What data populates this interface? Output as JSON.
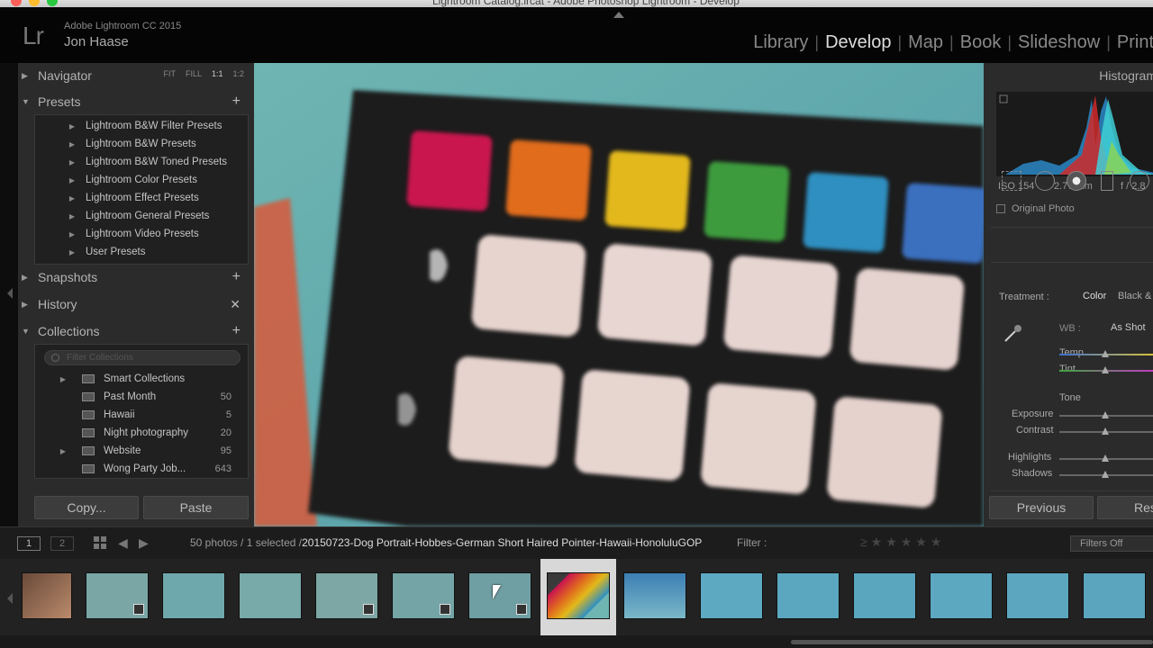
{
  "window": {
    "title": "Lightroom Catalog.lrcat - Adobe Photoshop Lightroom - Develop"
  },
  "identity": {
    "logo": "Lr",
    "product": "Adobe Lightroom CC 2015",
    "user": "Jon Haase"
  },
  "modules": [
    "Library",
    "Develop",
    "Map",
    "Book",
    "Slideshow",
    "Print"
  ],
  "active_module": "Develop",
  "left_panel": {
    "navigator": {
      "label": "Navigator",
      "options": [
        "FIT",
        "FILL",
        "1:1",
        "1:2"
      ]
    },
    "presets": {
      "label": "Presets",
      "items": [
        "Lightroom B&W Filter Presets",
        "Lightroom B&W Presets",
        "Lightroom B&W Toned Presets",
        "Lightroom Color Presets",
        "Lightroom Effect Presets",
        "Lightroom General Presets",
        "Lightroom Video Presets",
        "User Presets"
      ]
    },
    "snapshots": {
      "label": "Snapshots"
    },
    "history": {
      "label": "History"
    },
    "collections": {
      "label": "Collections",
      "filter_placeholder": "Filter Collections",
      "items": [
        {
          "name": "Smart Collections",
          "count": ""
        },
        {
          "name": "Past Month",
          "count": "50"
        },
        {
          "name": "Hawaii",
          "count": "5"
        },
        {
          "name": "Night photography",
          "count": "20"
        },
        {
          "name": "Website",
          "count": "95"
        },
        {
          "name": "Wong Party Job...",
          "count": "643"
        }
      ]
    },
    "copy_label": "Copy...",
    "paste_label": "Paste"
  },
  "right_panel": {
    "title": "Histogram",
    "iso": "ISO 154",
    "focal": "2.77 mm",
    "aperture": "f / 2.8",
    "original_photo": "Original Photo",
    "treatment_label": "Treatment :",
    "treatment_color": "Color",
    "treatment_bw": "Black & White",
    "wb_label": "WB :",
    "wb_value": "As Shot",
    "temp_label": "Temp",
    "tint_label": "Tint",
    "tone_label": "Tone",
    "exposure_label": "Exposure",
    "contrast_label": "Contrast",
    "highlights_label": "Highlights",
    "shadows_label": "Shadows",
    "previous_label": "Previous",
    "reset_label": "Reset"
  },
  "filmstrip_bar": {
    "page1": "1",
    "page2": "2",
    "photo_count": "50 photos / 1 selected /",
    "path": "20150723-Dog Portrait-Hobbes-German Short Haired Pointer-Hawaii-HonoluluGOP",
    "filter_label": "Filter :",
    "filters_off": "Filters Off"
  },
  "colors": {
    "checker_swatches": [
      "#c9134f",
      "#e06c1e",
      "#e3b81a",
      "#3e9b3e",
      "#2f8fc0",
      "#3a6fbf"
    ],
    "water": "#5aa0a5",
    "panel_bg": "#2b2b2b"
  }
}
